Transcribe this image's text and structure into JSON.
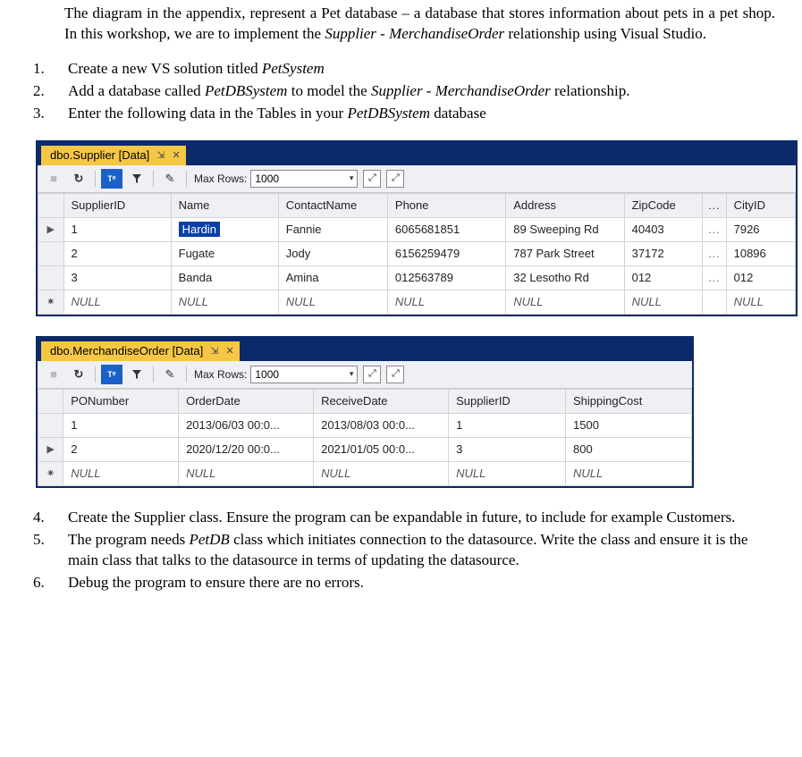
{
  "intro": {
    "p1a": "The diagram in the appendix, represent a Pet database – a database that stores information about pets in a pet shop. In this workshop, we are to implement the ",
    "p1b": "Supplier",
    "p1c": " - ",
    "p1d": "MerchandiseOrder",
    "p1e": " relationship using Visual Studio."
  },
  "steps123": {
    "s1a": "Create a new VS solution titled ",
    "s1b": "PetSystem",
    "s2a": "Add a database called ",
    "s2b": "PetDBSystem",
    "s2c": " to model the ",
    "s2d": "Supplier - MerchandiseOrder",
    "s2e": " relationship.",
    "s3a": "Enter the following data in the Tables in your ",
    "s3b": "PetDBSystem",
    "s3c": " database"
  },
  "panel1": {
    "tab_title": "dbo.Supplier [Data]",
    "maxrows_label": "Max Rows:",
    "maxrows_value": "1000",
    "headers": [
      "SupplierID",
      "Name",
      "ContactName",
      "Phone",
      "Address",
      "ZipCode",
      "CityID"
    ],
    "rows": [
      {
        "marker": "▶",
        "cells": [
          "1",
          "Hardin",
          "Fannie",
          "6065681851",
          "89 Sweeping Rd",
          "40403",
          "7926"
        ],
        "sel": 1
      },
      {
        "marker": "",
        "cells": [
          "2",
          "Fugate",
          "Jody",
          "6156259479",
          "787 Park Street",
          "37172",
          "10896"
        ]
      },
      {
        "marker": "",
        "cells": [
          "3",
          "Banda",
          "Amina",
          "012563789",
          "32 Lesotho Rd",
          "012",
          "012"
        ]
      },
      {
        "marker": "✷",
        "cells": [
          "NULL",
          "NULL",
          "NULL",
          "NULL",
          "NULL",
          "NULL",
          "NULL"
        ],
        "null": true
      }
    ]
  },
  "panel2": {
    "tab_title": "dbo.MerchandiseOrder [Data]",
    "maxrows_label": "Max Rows:",
    "maxrows_value": "1000",
    "headers": [
      "PONumber",
      "OrderDate",
      "ReceiveDate",
      "SupplierID",
      "ShippingCost"
    ],
    "rows": [
      {
        "marker": "",
        "cells": [
          "1",
          "2013/06/03 00:0...",
          "2013/08/03 00:0...",
          "1",
          "1500"
        ]
      },
      {
        "marker": "▶",
        "cells": [
          "2",
          "2020/12/20 00:0...",
          "2021/01/05 00:0...",
          "3",
          "800"
        ]
      },
      {
        "marker": "✷",
        "cells": [
          "NULL",
          "NULL",
          "NULL",
          "NULL",
          "NULL"
        ],
        "null": true
      }
    ]
  },
  "steps456": {
    "s4": "Create the Supplier class. Ensure the program can be expandable in future, to include for example Customers.",
    "s5a": "The program needs ",
    "s5b": "PetDB",
    "s5c": " class which initiates connection to the datasource. Write the class and ensure it is the main class that talks to the datasource in terms of updating the datasource.",
    "s6": "Debug the program to ensure there are no errors."
  },
  "icons": {
    "ellipsis": "..."
  }
}
